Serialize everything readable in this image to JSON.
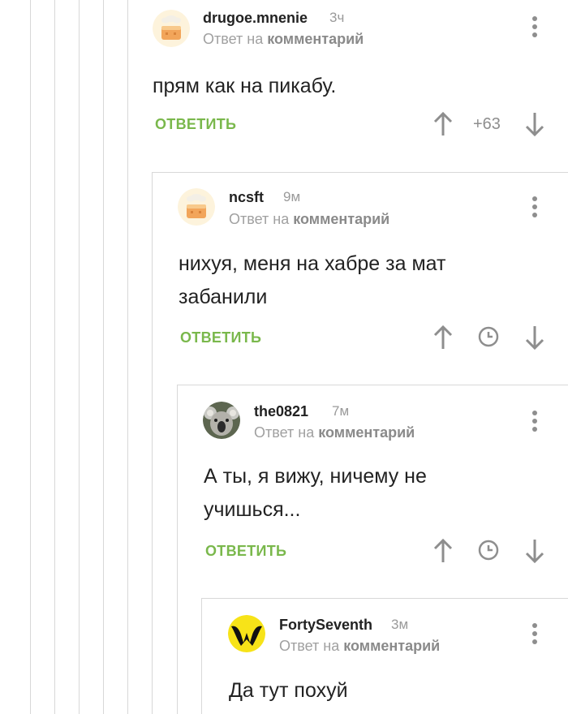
{
  "colors": {
    "accent": "#7ab84c",
    "muted": "#8e8e8e",
    "line": "#d8d8d8"
  },
  "comments": [
    {
      "author": "drugoe.mnenie",
      "time": "3ч",
      "reply_prefix": "Ответ на",
      "reply_target": "комментарий",
      "text": "прям как на пикабу.",
      "reply_label": "ОТВЕТИТЬ",
      "rating": "+63",
      "avatar": "default-cake-avatar"
    },
    {
      "author": "ncsft",
      "time": "9м",
      "reply_prefix": "Ответ на",
      "reply_target": "комментарий",
      "text": "нихуя, меня на хабре  за мат забанили",
      "reply_label": "ОТВЕТИТЬ",
      "rating_icon": "clock-icon",
      "avatar": "default-cake-avatar"
    },
    {
      "author": "the0821",
      "time": "7м",
      "reply_prefix": "Ответ на",
      "reply_target": "комментарий",
      "text": "А ты, я вижу, ничему не учишься...",
      "reply_label": "ОТВЕТИТЬ",
      "rating_icon": "clock-icon",
      "avatar": "koala-photo-avatar"
    },
    {
      "author": "FortySeventh",
      "time": "3м",
      "reply_prefix": "Ответ на",
      "reply_target": "комментарий",
      "text": "Да тут похуй",
      "avatar": "wu-tang-logo-avatar"
    }
  ]
}
